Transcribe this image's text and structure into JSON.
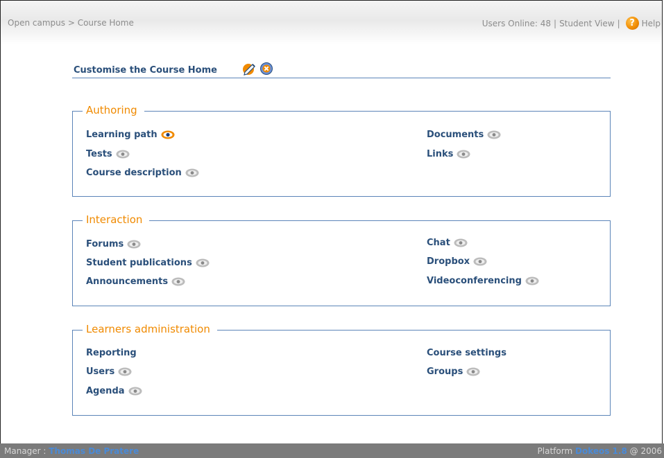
{
  "header": {
    "breadcrumb_home": "Open campus",
    "breadcrumb_sep": ">",
    "breadcrumb_current": "Course Home",
    "users_online": "Users Online: 48",
    "sep1": "|",
    "student_view": "Student View",
    "sep2": "|",
    "help": "Help"
  },
  "customise": {
    "label": "Customise the Course Home"
  },
  "sections": {
    "authoring": {
      "title": "Authoring",
      "items": [
        "Learning path",
        "Tests",
        "Course description",
        "Documents",
        "Links"
      ]
    },
    "interaction": {
      "title": "Interaction",
      "items": [
        "Forums",
        "Student publications",
        "Announcements",
        "Chat",
        "Dropbox",
        "Videoconferencing"
      ]
    },
    "admin": {
      "title": "Learners administration",
      "items": [
        "Reporting",
        "Users",
        "Agenda",
        "Course settings",
        "Groups"
      ]
    }
  },
  "footer": {
    "manager_label": "Manager :",
    "manager_name": "Thomas De Pratere",
    "platform_label": "Platform",
    "platform_name": "Dokeos 1.8",
    "platform_year": "@ 2006"
  },
  "colors": {
    "accent": "#f08a00",
    "link": "#2a4f7a",
    "border": "#5b84b8",
    "footer_bg": "#7b7b7b"
  }
}
